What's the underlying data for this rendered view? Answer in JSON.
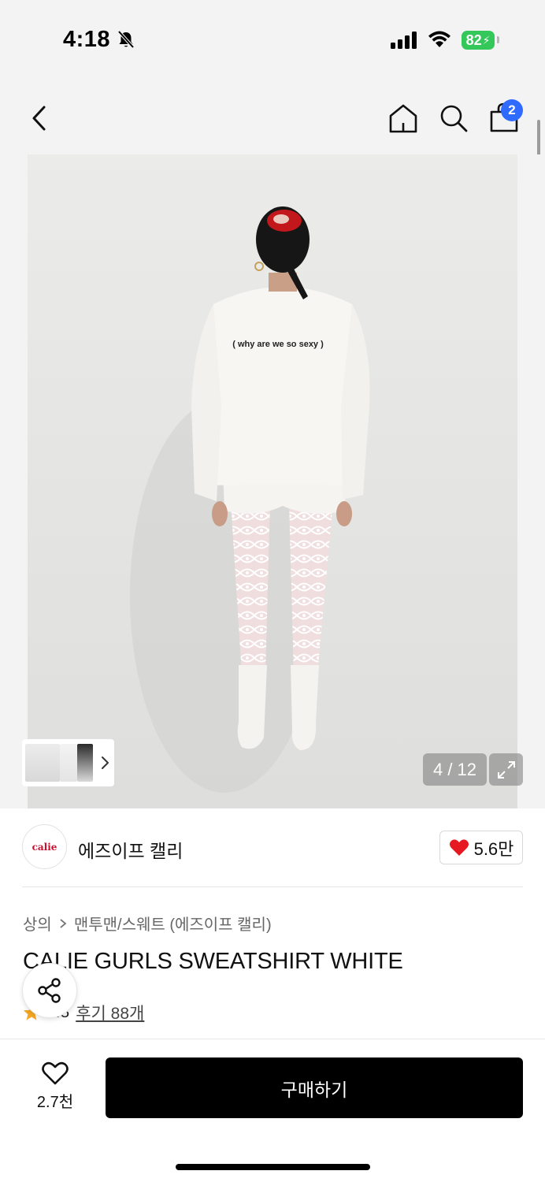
{
  "status_bar": {
    "time": "4:18",
    "battery": "82"
  },
  "nav": {
    "cart_count": "2",
    "icons": [
      "chevron-left-icon",
      "home-icon",
      "search-icon",
      "shopping-bag-icon"
    ]
  },
  "gallery": {
    "counter": "4 / 12",
    "photo_text": "( why are we so sexy )"
  },
  "brand": {
    "logo_text": "calie",
    "name": "에즈이프 캘리",
    "likes": "5.6만"
  },
  "product": {
    "breadcrumb_category": "상의",
    "breadcrumb_sub": "맨투맨/스웨트 (에즈이프 캘리)",
    "title": "CALIE GURLS SWEATSHIRT WHITE",
    "rating": "4.8",
    "reviews": "후기 88개"
  },
  "bottom": {
    "wish_count": "2.7천",
    "buy_label": "구매하기"
  },
  "colors": {
    "accent_badge": "#2f6bff",
    "battery": "#34c759",
    "heart": "#e5191f",
    "star": "#f5a623"
  }
}
